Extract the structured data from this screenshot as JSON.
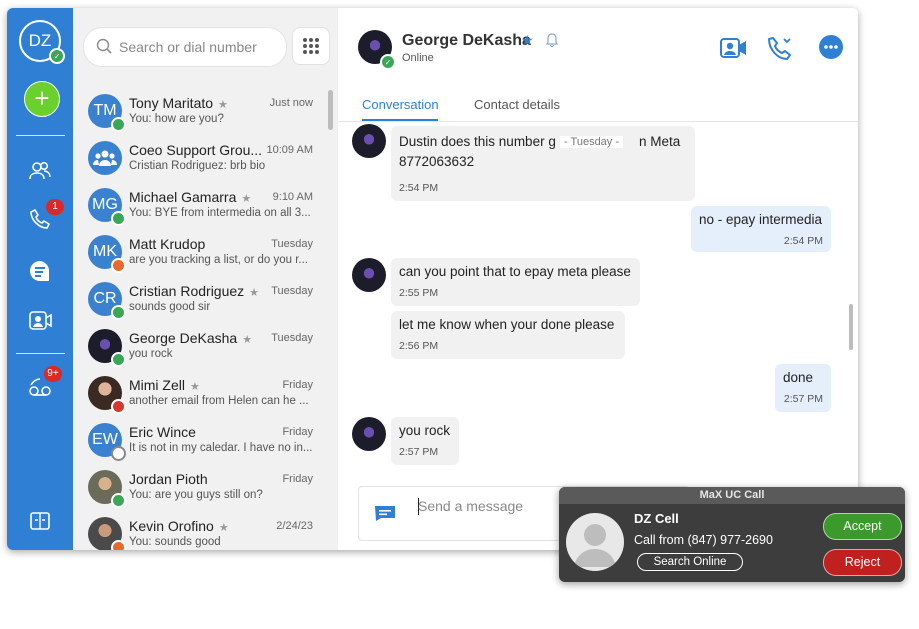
{
  "colors": {
    "rail": "#2f7fd4",
    "accent": "#2f7fd4",
    "online": "#3aa757",
    "add": "#6ad12c",
    "busy": "#e8692b",
    "dnd": "#d9362b",
    "badge": "#d92a2a"
  },
  "rail": {
    "initials": "DZ",
    "calls_badge": "1",
    "voicemail_badge": "9+",
    "icons": [
      "new-item-icon",
      "contacts-icon",
      "phone-icon",
      "chat-icon",
      "video-icon",
      "voicemail-icon",
      "help-icon"
    ]
  },
  "search": {
    "placeholder": "Search or dial number"
  },
  "contacts": [
    {
      "initials": "TM",
      "name": "Tony Maritato",
      "starred": true,
      "time": "Just now",
      "preview": "You: how are you?",
      "status": "online"
    },
    {
      "initials": "",
      "name": "Coeo Support Grou...",
      "starred": false,
      "time": "10:09 AM",
      "preview": "Cristian Rodriguez: brb bio",
      "status": "none"
    },
    {
      "initials": "MG",
      "name": "Michael Gamarra",
      "starred": true,
      "time": "9:10 AM",
      "preview": "You: BYE from intermedia on all 3...",
      "status": "online"
    },
    {
      "initials": "MK",
      "name": "Matt Krudop",
      "starred": false,
      "time": "Tuesday",
      "preview": "are you tracking a list, or do you r...",
      "status": "busy"
    },
    {
      "initials": "CR",
      "name": "Cristian Rodriguez",
      "starred": true,
      "time": "Tuesday",
      "preview": "sounds good sir",
      "status": "online"
    },
    {
      "initials": "",
      "name": "George DeKasha",
      "starred": true,
      "time": "Tuesday",
      "preview": "you rock",
      "status": "online"
    },
    {
      "initials": "",
      "name": "Mimi Zell",
      "starred": true,
      "time": "Friday",
      "preview": "another email from Helen can he ...",
      "status": "dnd"
    },
    {
      "initials": "EW",
      "name": "Eric Wince",
      "starred": false,
      "time": "Friday",
      "preview": "It is not in my caledar. I have no in...",
      "status": "offline"
    },
    {
      "initials": "",
      "name": "Jordan Pioth",
      "starred": false,
      "time": "Friday",
      "preview": "You: are you guys still on?",
      "status": "online"
    },
    {
      "initials": "",
      "name": "Kevin Orofino",
      "starred": true,
      "time": "2/24/23",
      "preview": "You: sounds good",
      "status": "busy"
    }
  ],
  "conversation": {
    "name": "George DeKasha",
    "status": "Online",
    "tabs": [
      "Conversation",
      "Contact details"
    ],
    "day_divider": "- Tuesday -",
    "messages": [
      {
        "dir": "in",
        "text": "Dustin does this number go to epay Meta 8772063632",
        "line1": "Dustin does this number g",
        "line1b": "n Meta",
        "line2": "8772063632",
        "time": "2:54 PM"
      },
      {
        "dir": "out",
        "text": "no - epay intermedia",
        "time": "2:54 PM"
      },
      {
        "dir": "in",
        "text": "can you point that to epay meta please",
        "time": "2:55 PM"
      },
      {
        "dir": "in",
        "text": "let me know when your done please",
        "time": "2:56 PM"
      },
      {
        "dir": "out",
        "text": "done",
        "time": "2:57 PM"
      },
      {
        "dir": "in",
        "text": "you rock",
        "time": "2:57 PM"
      }
    ],
    "composer_placeholder": "Send a message"
  },
  "call_popup": {
    "title": "MaX UC Call",
    "caller": "DZ Cell",
    "from": "Call from (847) 977-2690",
    "search_online": "Search Online",
    "accept": "Accept",
    "reject": "Reject"
  }
}
